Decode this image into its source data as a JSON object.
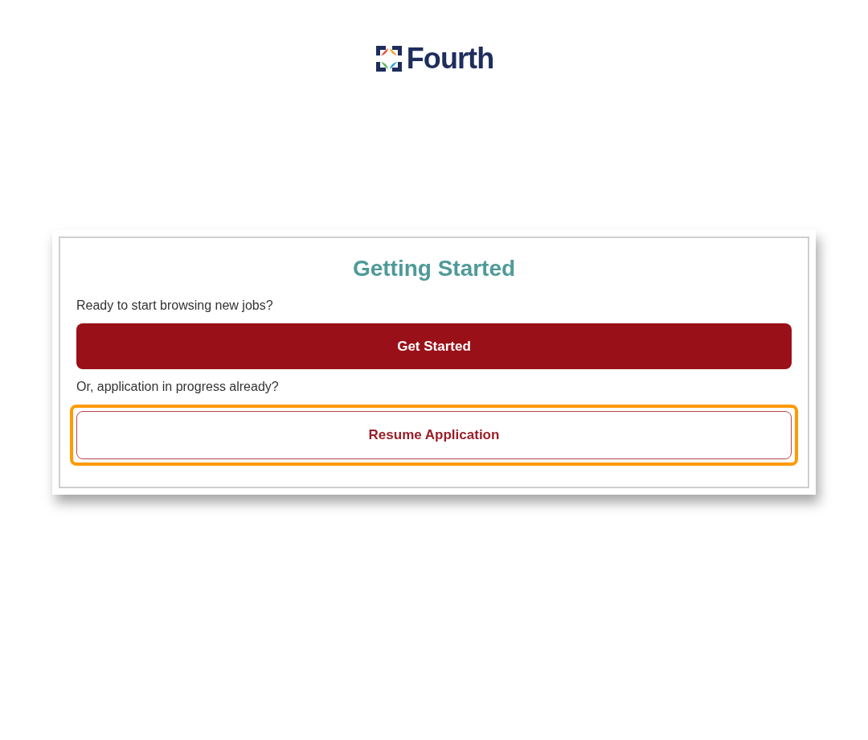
{
  "logo": {
    "text": "Fourth"
  },
  "card": {
    "title": "Getting Started",
    "sections": [
      {
        "prompt": "Ready to start browsing new jobs?",
        "button": {
          "label": "Get Started",
          "kind": "primary",
          "highlighted": false
        }
      },
      {
        "prompt": "Or, application in progress already?",
        "button": {
          "label": "Resume Application",
          "kind": "outline",
          "highlighted": true
        }
      }
    ]
  }
}
